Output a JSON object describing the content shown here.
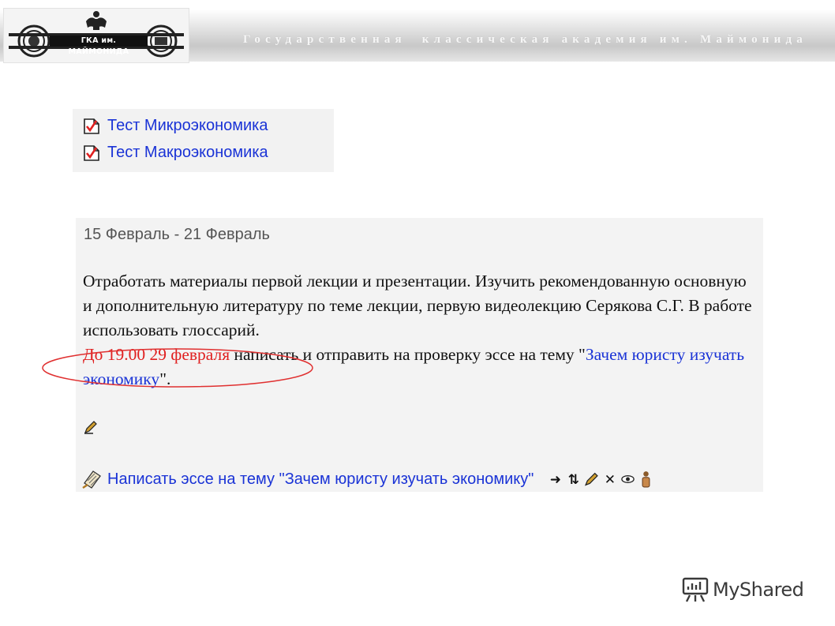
{
  "header": {
    "title": "Государственная  классическая академия им. Маймонида",
    "logo_text": "ГКА им. МАЙМОНИДА"
  },
  "tests": [
    {
      "label": "Тест Микроэкономика",
      "icon": "quiz-checkbox-icon"
    },
    {
      "label": "Тест Макроэкономика",
      "icon": "quiz-checkbox-icon"
    }
  ],
  "topic": {
    "date_range": "15 Февраль - 21 Февраль",
    "body_text": "Отработать материалы первой лекции и презентации. Изучить рекомендованную основную и дополнительную литературу по теме лекции, первую видеолекцию Серякова С.Г. В работе использовать глоссарий.",
    "deadline": "До 19.00 29 февраля",
    "task_text": " написать и отправить на проверку эссе на тему \"",
    "essay_topic": "Зачем юристу изучать экономику",
    "task_end": "\".",
    "assignment_label": "Написать эссе на тему \"Зачем юристу изучать экономику\"",
    "tools": [
      "arrow-right-icon",
      "move-updown-icon",
      "edit-icon",
      "delete-icon",
      "eye-icon",
      "role-icon"
    ]
  },
  "colors": {
    "link": "#1a33d6",
    "deadline": "#e02020",
    "annotation_oval": "#e03030",
    "topic_background": "#f3f3f3"
  },
  "watermark": {
    "text": "MyShared"
  }
}
